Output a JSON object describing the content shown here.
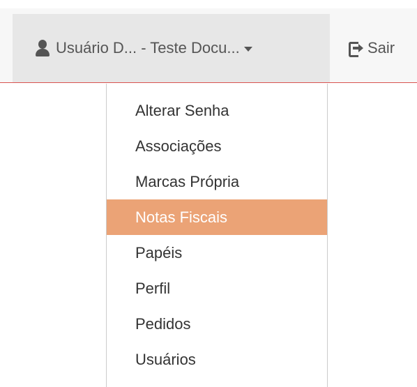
{
  "navbar": {
    "user_menu_label": "Usuário D... - Teste Docu...",
    "logout_label": "Sair",
    "colors": {
      "navbar_bg": "#f7f7f7",
      "toggle_active_bg": "#e7e7e7",
      "accent_border": "#d9534f",
      "text": "#555555"
    }
  },
  "dropdown": {
    "items": [
      {
        "label": "Alterar Senha"
      },
      {
        "label": "Associações"
      },
      {
        "label": "Marcas Própria"
      },
      {
        "label": "Notas Fiscais",
        "highlighted": true
      },
      {
        "label": "Papéis"
      },
      {
        "label": "Perfil"
      },
      {
        "label": "Pedidos"
      },
      {
        "label": "Usuários"
      }
    ],
    "highlight_color": "#eba376"
  },
  "icons": {
    "user": "user-icon",
    "caret": "caret-down-icon",
    "logout": "logout-icon"
  }
}
